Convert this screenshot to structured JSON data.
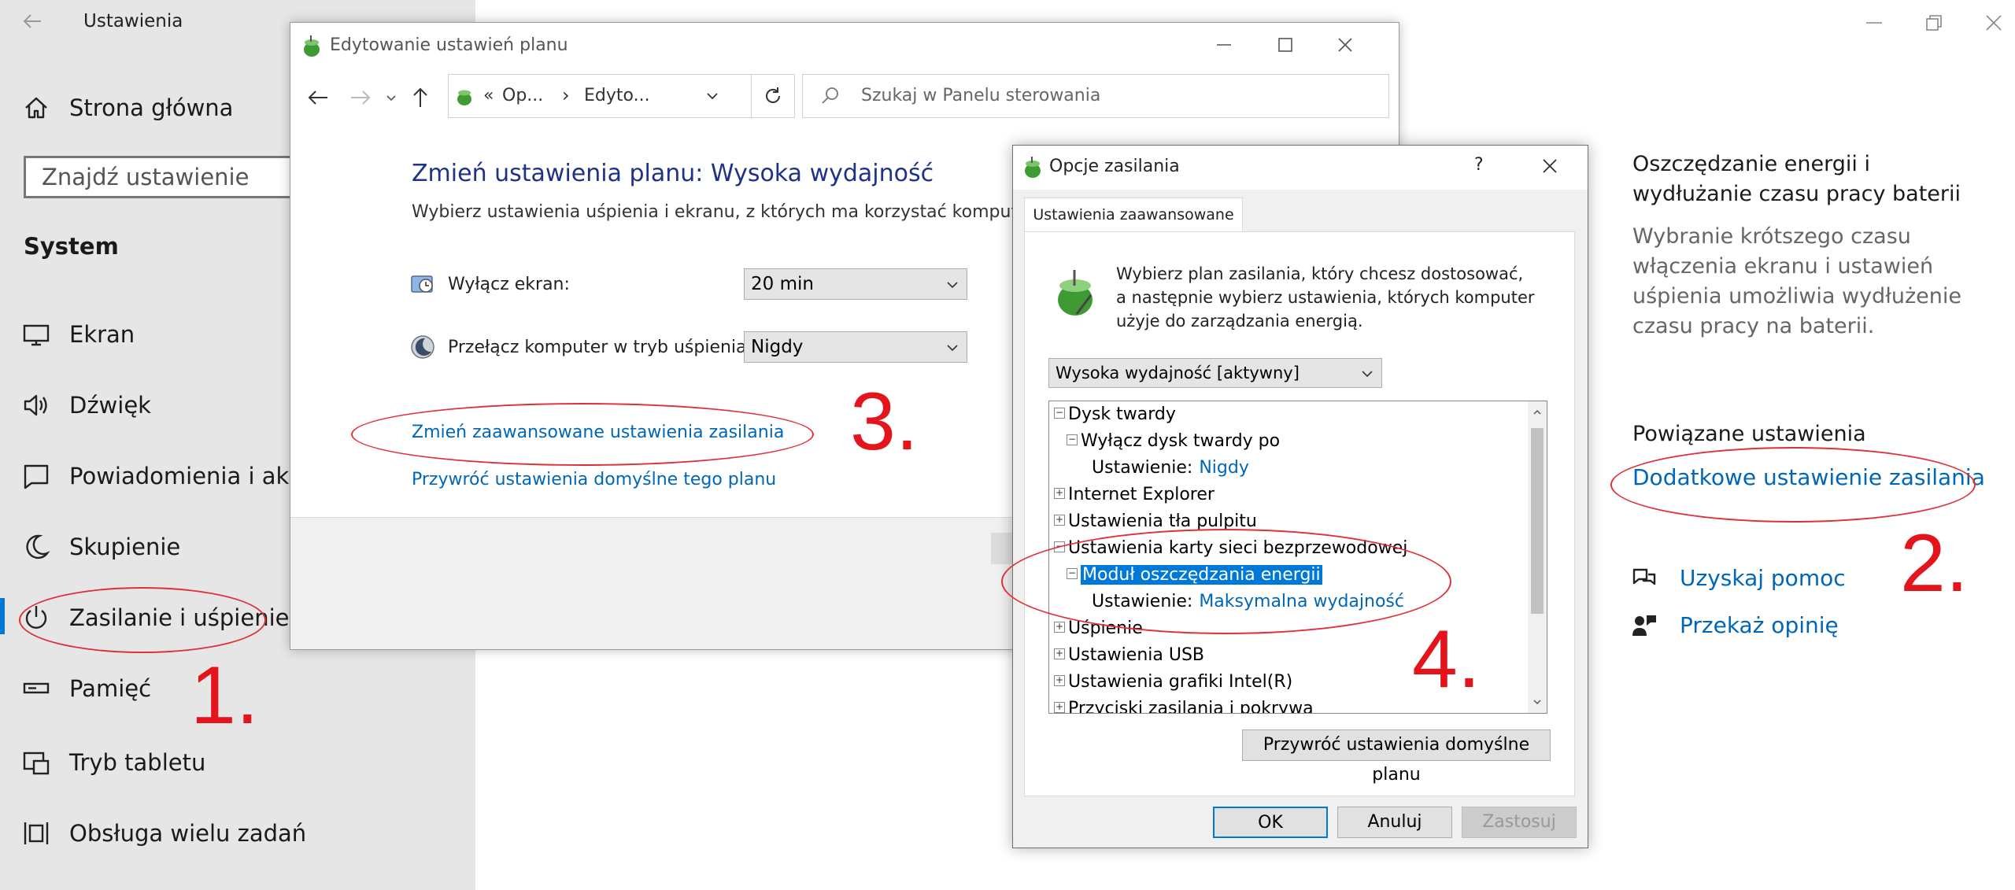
{
  "settings": {
    "title": "Ustawienia",
    "home": "Strona główna",
    "search_placeholder": "Znajdź ustawienie",
    "section": "System",
    "nav": [
      {
        "label": "Ekran",
        "icon": "monitor-icon"
      },
      {
        "label": "Dźwięk",
        "icon": "speaker-icon"
      },
      {
        "label": "Powiadomienia i akcje",
        "icon": "notification-icon"
      },
      {
        "label": "Skupienie",
        "icon": "moon-icon"
      },
      {
        "label": "Zasilanie i uśpienie",
        "icon": "power-icon"
      },
      {
        "label": "Pamięć",
        "icon": "storage-icon"
      },
      {
        "label": "Tryb tabletu",
        "icon": "tablet-icon"
      },
      {
        "label": "Obsługa wielu zadań",
        "icon": "multitask-icon"
      }
    ],
    "right": {
      "heading": "Oszczędzanie energii i wydłużanie czasu pracy baterii",
      "description": "Wybranie krótszego czasu włączenia ekranu i ustawień uśpienia umożliwia wydłużenie czasu pracy na baterii.",
      "related_title": "Powiązane ustawienia",
      "related_link": "Dodatkowe ustawienie zasilania",
      "help": "Uzyskaj pomoc",
      "feedback": "Przekaż opinię"
    }
  },
  "plan_window": {
    "title": "Edytowanie ustawień planu",
    "breadcrumb_prefix": "«",
    "breadcrumb_1": "Op...",
    "breadcrumb_sep": "›",
    "breadcrumb_2": "Edyto...",
    "search_placeholder": "Szukaj w Panelu sterowania",
    "heading": "Zmień ustawienia planu: Wysoka wydajność",
    "subheading": "Wybierz ustawienia uśpienia i ekranu, z których ma korzystać komputer.",
    "display_label": "Wyłącz ekran:",
    "display_value": "20 min",
    "sleep_label": "Przełącz komputer w tryb uśpienia:",
    "sleep_value": "Nigdy",
    "advanced_link": "Zmień zaawansowane ustawienia zasilania",
    "restore_link": "Przywróć ustawienia domyślne tego planu"
  },
  "power_dialog": {
    "title": "Opcje zasilania",
    "help": "?",
    "tab": "Ustawienia zaawansowane",
    "intro_line1": "Wybierz plan zasilania, który chcesz dostosować,",
    "intro_line2": "a następnie wybierz ustawienia, których komputer",
    "intro_line3": "użyje do zarządzania energią.",
    "plan": "Wysoka wydajność [aktywny]",
    "tree": [
      {
        "label": "Dysk twardy",
        "level": 0,
        "exp": "−"
      },
      {
        "label": "Wyłącz dysk twardy po",
        "level": 1,
        "exp": "−"
      },
      {
        "label": "Ustawienie:",
        "value": "Nigdy",
        "level": 2
      },
      {
        "label": "Internet Explorer",
        "level": 0,
        "exp": "+"
      },
      {
        "label": "Ustawienia tła pulpitu",
        "level": 0,
        "exp": "+"
      },
      {
        "label": "Ustawienia karty sieci bezprzewodowej",
        "level": 0,
        "exp": "−"
      },
      {
        "label": "Moduł oszczędzania energii",
        "level": 1,
        "exp": "−",
        "selected": true
      },
      {
        "label": "Ustawienie:",
        "value": "Maksymalna wydajność",
        "level": 2
      },
      {
        "label": "Uśpienie",
        "level": 0,
        "exp": "+"
      },
      {
        "label": "Ustawienia USB",
        "level": 0,
        "exp": "+"
      },
      {
        "label": "Ustawienia grafiki Intel(R)",
        "level": 0,
        "exp": "+"
      },
      {
        "label": "Przyciski zasilania i pokrywa",
        "level": 0,
        "exp": "+"
      }
    ],
    "restore_btn": "Przywróć ustawienia domyślne planu",
    "ok": "OK",
    "cancel": "Anuluj",
    "apply": "Zastosuj"
  },
  "annotations": {
    "n1": "1.",
    "n2": "2.",
    "n3": "3.",
    "n4": "4."
  },
  "colors": {
    "accent": "#0078d7",
    "link": "#0067b8",
    "annotation": "#e4141c",
    "selection": "#0078d7"
  }
}
